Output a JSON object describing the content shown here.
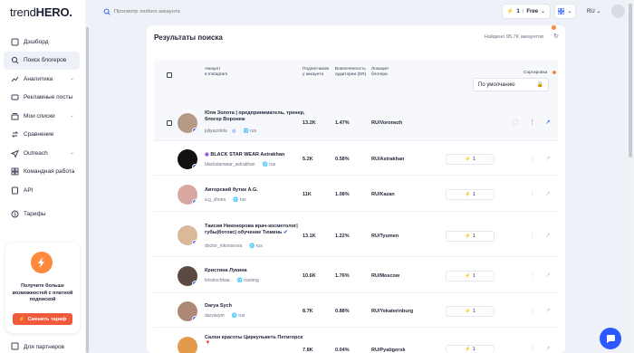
{
  "app": {
    "logo_light": "trend",
    "logo_bold": "HERO."
  },
  "sidebar": {
    "items": [
      {
        "label": "Дэшборд",
        "icon": "dashboard-icon"
      },
      {
        "label": "Поиск блогеров",
        "icon": "search-icon"
      },
      {
        "label": "Аналитика",
        "icon": "analytics-icon"
      },
      {
        "label": "Рекламные посты",
        "icon": "posts-icon"
      },
      {
        "label": "Мои списки",
        "icon": "lists-icon"
      },
      {
        "label": "Сравнение",
        "icon": "compare-icon"
      },
      {
        "label": "Outreach",
        "icon": "outreach-icon"
      },
      {
        "label": "Командная работа",
        "icon": "team-icon"
      },
      {
        "label": "API",
        "icon": "api-icon"
      },
      {
        "label": "Тарифы",
        "icon": "tariffs-icon"
      }
    ],
    "promo": {
      "text": "Получите больше возможностей с платной подпиской",
      "button": "Сменить тариф"
    },
    "partners": "Для партнеров"
  },
  "topbar": {
    "search_placeholder": "Просмотр любого аккаунта",
    "plan_count": "1",
    "plan_sep": "/",
    "plan_name": "Free",
    "language": "RU"
  },
  "results": {
    "title": "Результаты поиска",
    "count": "Найдено 95.7K аккаунтов",
    "columns": {
      "account": "Аккаунт\nв Instagram",
      "followers": "Подписчиков\nу аккаунта",
      "er": "Вовлечённость\nаудитории (ER)",
      "location": "Локация\nблогера",
      "sort_label": "Сортировка"
    },
    "sort_value": "По умолчанию",
    "rows": [
      {
        "name": "Юля Золота | предприниматель, тренер, блогер Воронеж",
        "handle": "juliyazolota",
        "geo": "rus",
        "followers": "13.2K",
        "er": "1.47%",
        "location": "RU/Voronezh"
      },
      {
        "name": "BLACK STAR WEAR Astrakhan",
        "handle": "blackstarwear_astrakhan",
        "geo": "rus",
        "followers": "5.2K",
        "er": "0.58%",
        "location": "RU/Astrakhan"
      },
      {
        "name": "Авторский бутик A.G.",
        "handle": "a.g_shoes",
        "geo": "rus",
        "followers": "11K",
        "er": "1.08%",
        "location": "RU/Kazan"
      },
      {
        "name": "Таисия Никонорова врач-косметолог| губы|ботокс| обучение Тюмень",
        "handle": "doctor_nikonorova",
        "geo": "rus",
        "followers": "13.1K",
        "er": "1.22%",
        "location": "RU/Tyumen"
      },
      {
        "name": "Кристина Лукина",
        "handle": "krisslochkaa",
        "geo": "rus/eng",
        "followers": "10.6K",
        "er": "1.76%",
        "location": "RU/Moscow"
      },
      {
        "name": "Darya Sych",
        "handle": "daryasym",
        "geo": "rus",
        "followers": "8.7K",
        "er": "0.88%",
        "location": "RU/Yekaterinburg"
      },
      {
        "name": "Салон красоты Циркульветь Петигорск",
        "handle": "",
        "geo": "",
        "followers": "7.8K",
        "er": "0.04%",
        "location": "RU/Pyatigorsk"
      }
    ]
  },
  "colors": {
    "accent": "#2b59ff",
    "orange": "#ff8a3d",
    "promo_button": "#f25a3c"
  }
}
